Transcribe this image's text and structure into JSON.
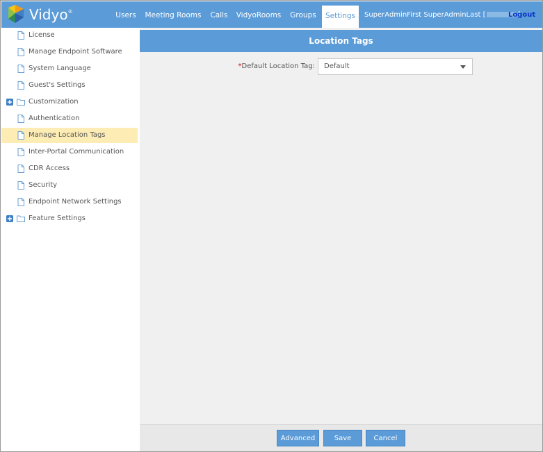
{
  "brand": {
    "name": "Vidyo",
    "mark": "®"
  },
  "nav": {
    "items": [
      {
        "label": "Users"
      },
      {
        "label": "Meeting Rooms"
      },
      {
        "label": "Calls"
      },
      {
        "label": "VidyoRooms"
      },
      {
        "label": "Groups"
      },
      {
        "label": "Settings",
        "active": true
      }
    ],
    "user_name": "SuperAdminFirst SuperAdminLast [",
    "user_bracket_close": "]",
    "logout_label": "Logout"
  },
  "sidebar": {
    "items": [
      {
        "label": "License",
        "icon": "file-icon"
      },
      {
        "label": "Manage Endpoint Software",
        "icon": "file-icon"
      },
      {
        "label": "System Language",
        "icon": "file-icon"
      },
      {
        "label": "Guest's Settings",
        "icon": "file-icon"
      },
      {
        "label": "Customization",
        "icon": "folder-icon",
        "expandable": true
      },
      {
        "label": "Authentication",
        "icon": "file-icon"
      },
      {
        "label": "Manage Location Tags",
        "icon": "file-icon",
        "selected": true
      },
      {
        "label": "Inter-Portal Communication",
        "icon": "file-icon"
      },
      {
        "label": "CDR Access",
        "icon": "file-icon"
      },
      {
        "label": "Security",
        "icon": "file-icon"
      },
      {
        "label": "Endpoint Network Settings",
        "icon": "file-icon"
      },
      {
        "label": "Feature Settings",
        "icon": "folder-icon",
        "expandable": true
      }
    ]
  },
  "main": {
    "title": "Location Tags",
    "field": {
      "required_mark": "*",
      "label": "Default Location Tag:",
      "value": "Default"
    }
  },
  "footer": {
    "advanced_label": "Advanced",
    "save_label": "Save",
    "cancel_label": "Cancel"
  },
  "colors": {
    "accent": "#5a9bd8",
    "selected_row": "#fdedb5",
    "logout_link": "#0a36c8",
    "required": "#d40000"
  }
}
